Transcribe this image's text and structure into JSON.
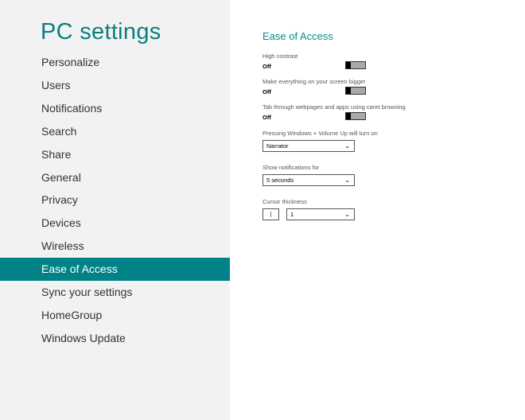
{
  "sidebar": {
    "title": "PC settings",
    "items": [
      {
        "label": "Personalize"
      },
      {
        "label": "Users"
      },
      {
        "label": "Notifications"
      },
      {
        "label": "Search"
      },
      {
        "label": "Share"
      },
      {
        "label": "General"
      },
      {
        "label": "Privacy"
      },
      {
        "label": "Devices"
      },
      {
        "label": "Wireless"
      },
      {
        "label": "Ease of Access",
        "selected": true
      },
      {
        "label": "Sync your settings"
      },
      {
        "label": "HomeGroup"
      },
      {
        "label": "Windows Update"
      }
    ]
  },
  "main": {
    "heading": "Ease of Access",
    "toggles": [
      {
        "label": "High contrast",
        "value": "Off"
      },
      {
        "label": "Make everything on your screen bigger",
        "value": "Off"
      },
      {
        "label": "Tab through webpages and apps using caret browsing",
        "value": "Off"
      }
    ],
    "dropdowns": [
      {
        "label": "Pressing Windows + Volume Up will turn on",
        "value": "Narrator"
      },
      {
        "label": "Show notifications for",
        "value": "5 seconds"
      },
      {
        "label": "Cursor thickness",
        "value": "1"
      }
    ],
    "colors": {
      "accent": "#008287"
    }
  }
}
